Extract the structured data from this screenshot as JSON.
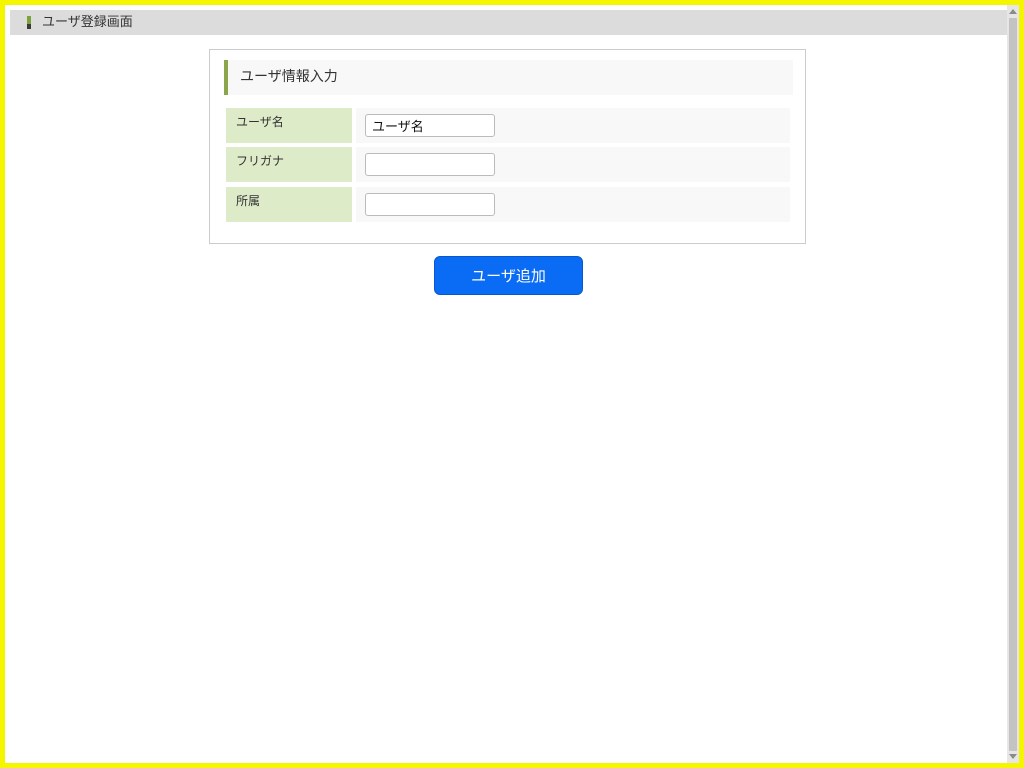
{
  "header": {
    "title": "ユーザ登録画面"
  },
  "panel": {
    "heading": "ユーザ情報入力",
    "fields": [
      {
        "label": "ユーザ名",
        "value": "ユーザ名",
        "placeholder": ""
      },
      {
        "label": "フリガナ",
        "value": "",
        "placeholder": ""
      },
      {
        "label": "所属",
        "value": "",
        "placeholder": ""
      }
    ]
  },
  "actions": {
    "add_user_label": "ユーザ追加"
  },
  "colors": {
    "frame_border": "#f5f500",
    "header_bg": "#dcdcdc",
    "heading_accent": "#8aa54a",
    "label_bg": "#deebc8",
    "button_bg": "#0a6cf5"
  }
}
